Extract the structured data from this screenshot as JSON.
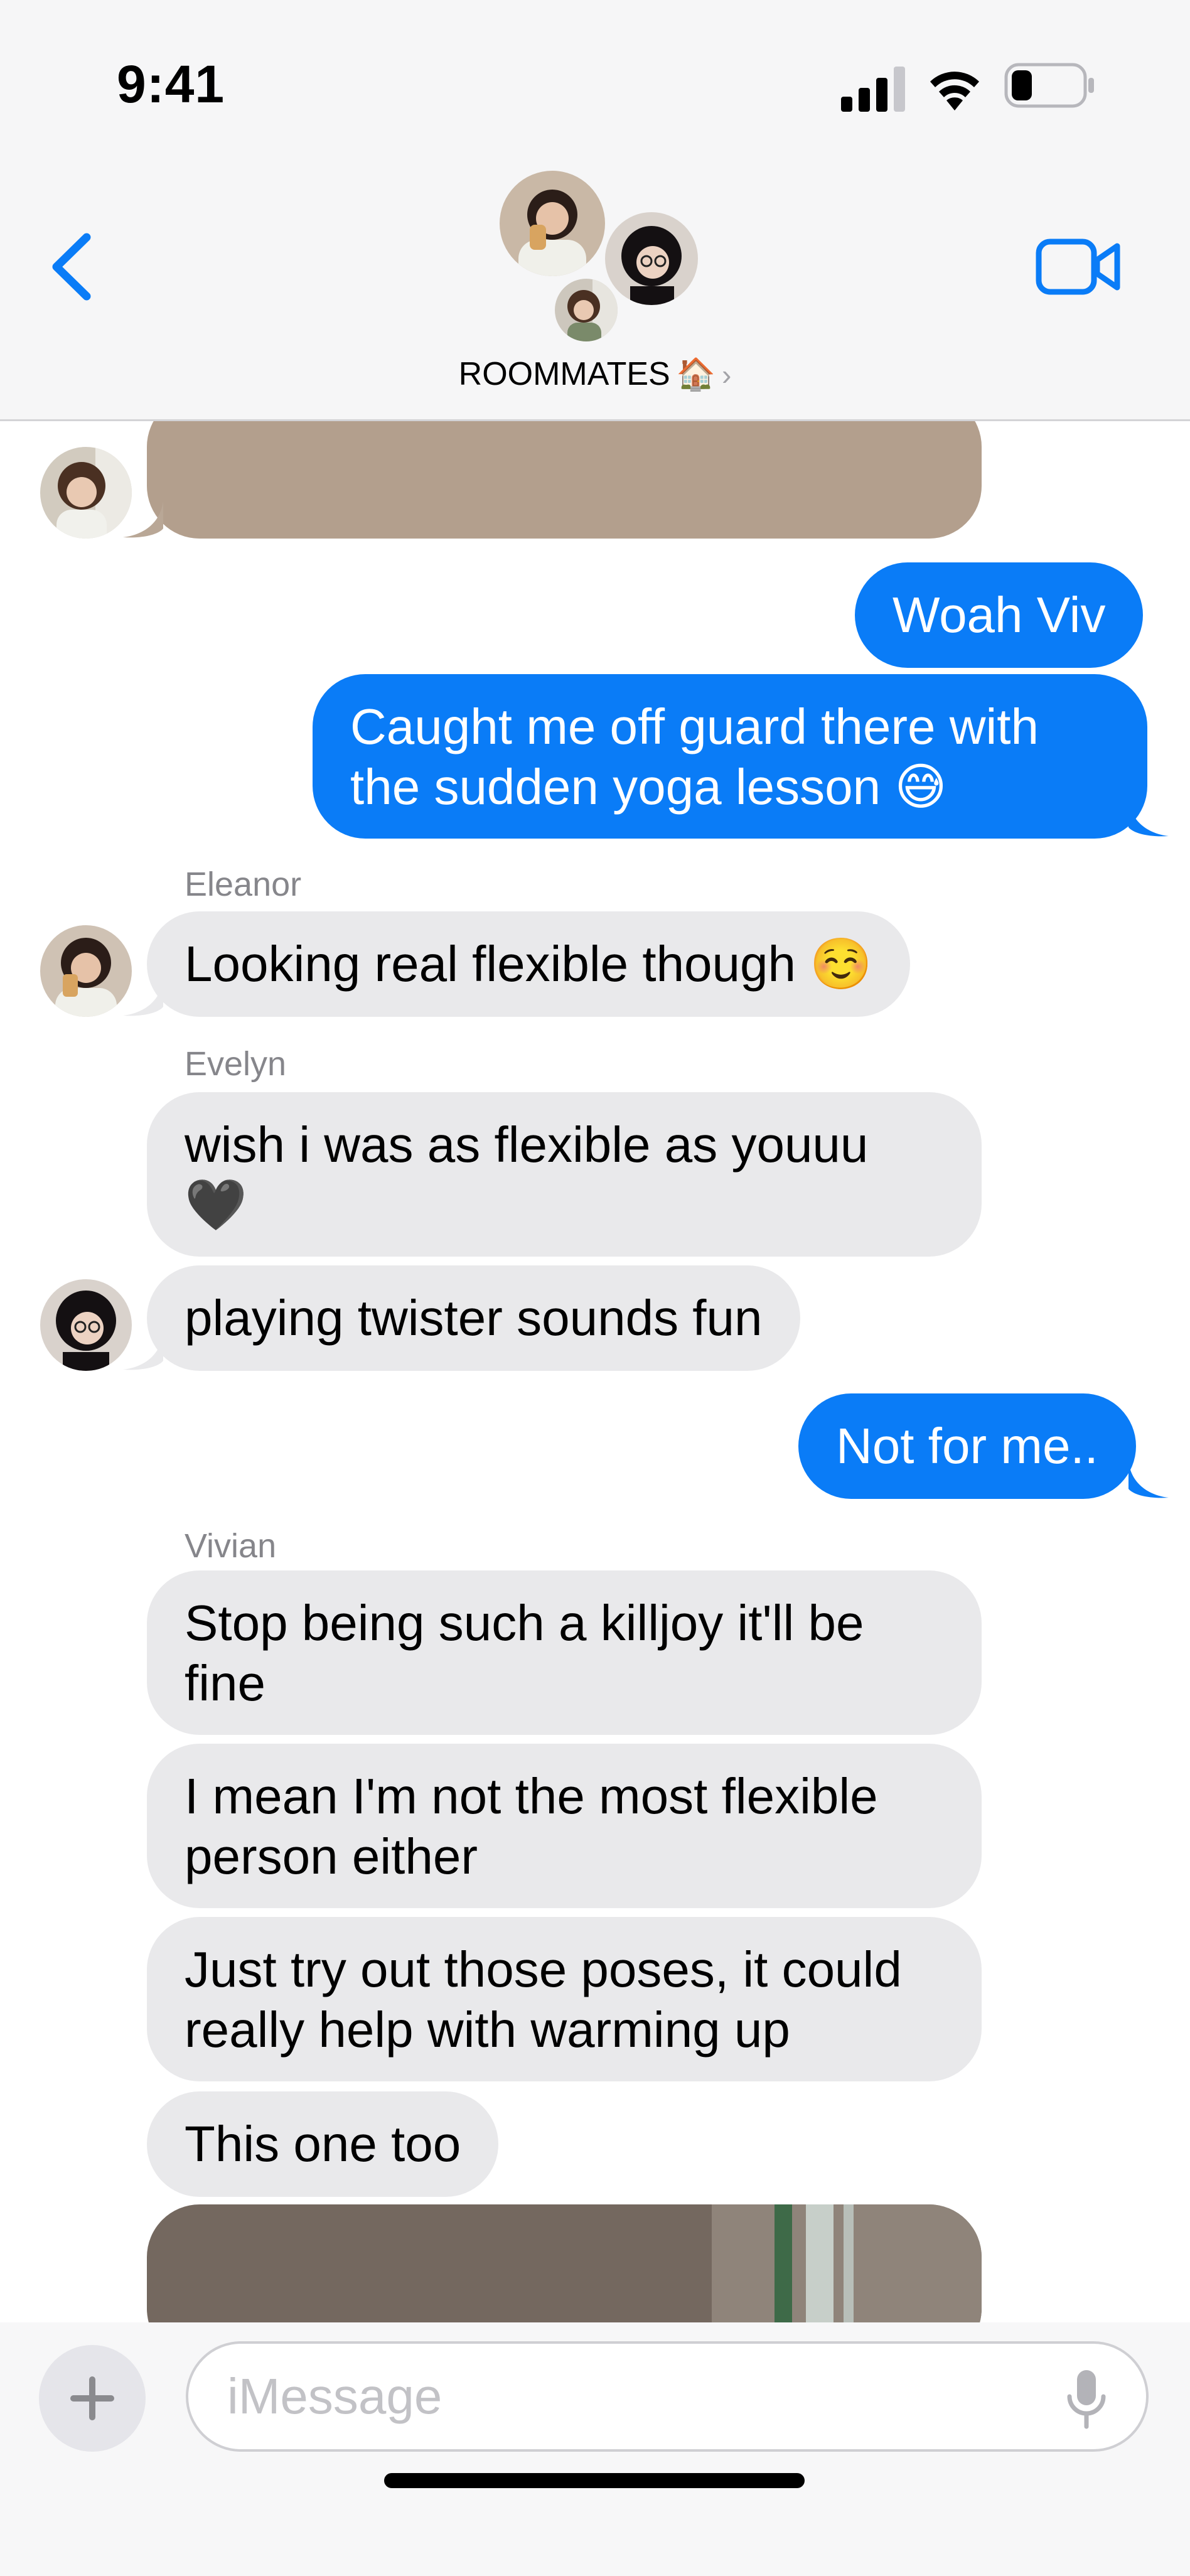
{
  "status_bar": {
    "time": "9:41"
  },
  "header": {
    "group_name": "ROOMMATES",
    "group_emoji": "🏠",
    "chevron": "›",
    "icons": [
      "back-chevron-icon",
      "video-camera-icon"
    ]
  },
  "messages": [
    {
      "id": 0,
      "dir": "in",
      "type": "photo",
      "sender": "Vivian"
    },
    {
      "id": 1,
      "dir": "out",
      "text": "Woah Viv"
    },
    {
      "id": 2,
      "dir": "out",
      "text": "Caught me off guard there with the sudden yoga lesson 😅"
    },
    {
      "id": 3,
      "dir": "in",
      "sender": "Eleanor",
      "text": "Looking real flexible though ☺️"
    },
    {
      "id": 4,
      "dir": "in",
      "sender": "Evelyn",
      "text": "wish i was as flexible as youuu 🖤"
    },
    {
      "id": 5,
      "dir": "in",
      "sender": "Evelyn",
      "text": "playing twister sounds fun"
    },
    {
      "id": 6,
      "dir": "out",
      "text": "Not for me.."
    },
    {
      "id": 7,
      "dir": "in",
      "sender": "Vivian",
      "text": "Stop being such a killjoy it'll be fine"
    },
    {
      "id": 8,
      "dir": "in",
      "sender": "Vivian",
      "text": "I mean I'm not the most flexible person either"
    },
    {
      "id": 9,
      "dir": "in",
      "sender": "Vivian",
      "text": "Just try out those poses, it could really help with warming up"
    },
    {
      "id": 10,
      "dir": "in",
      "sender": "Vivian",
      "text": "This one too"
    },
    {
      "id": 11,
      "dir": "in",
      "type": "photo",
      "sender": "Vivian"
    }
  ],
  "labels": {
    "eleanor": "Eleanor",
    "evelyn": "Evelyn",
    "vivian": "Vivian"
  },
  "composer": {
    "placeholder": "iMessage",
    "plus": "+"
  },
  "colors": {
    "accent": "#0a7cf7",
    "incoming_bubble": "#e9e9eb",
    "outgoing_bubble": "#0a7cf7"
  }
}
